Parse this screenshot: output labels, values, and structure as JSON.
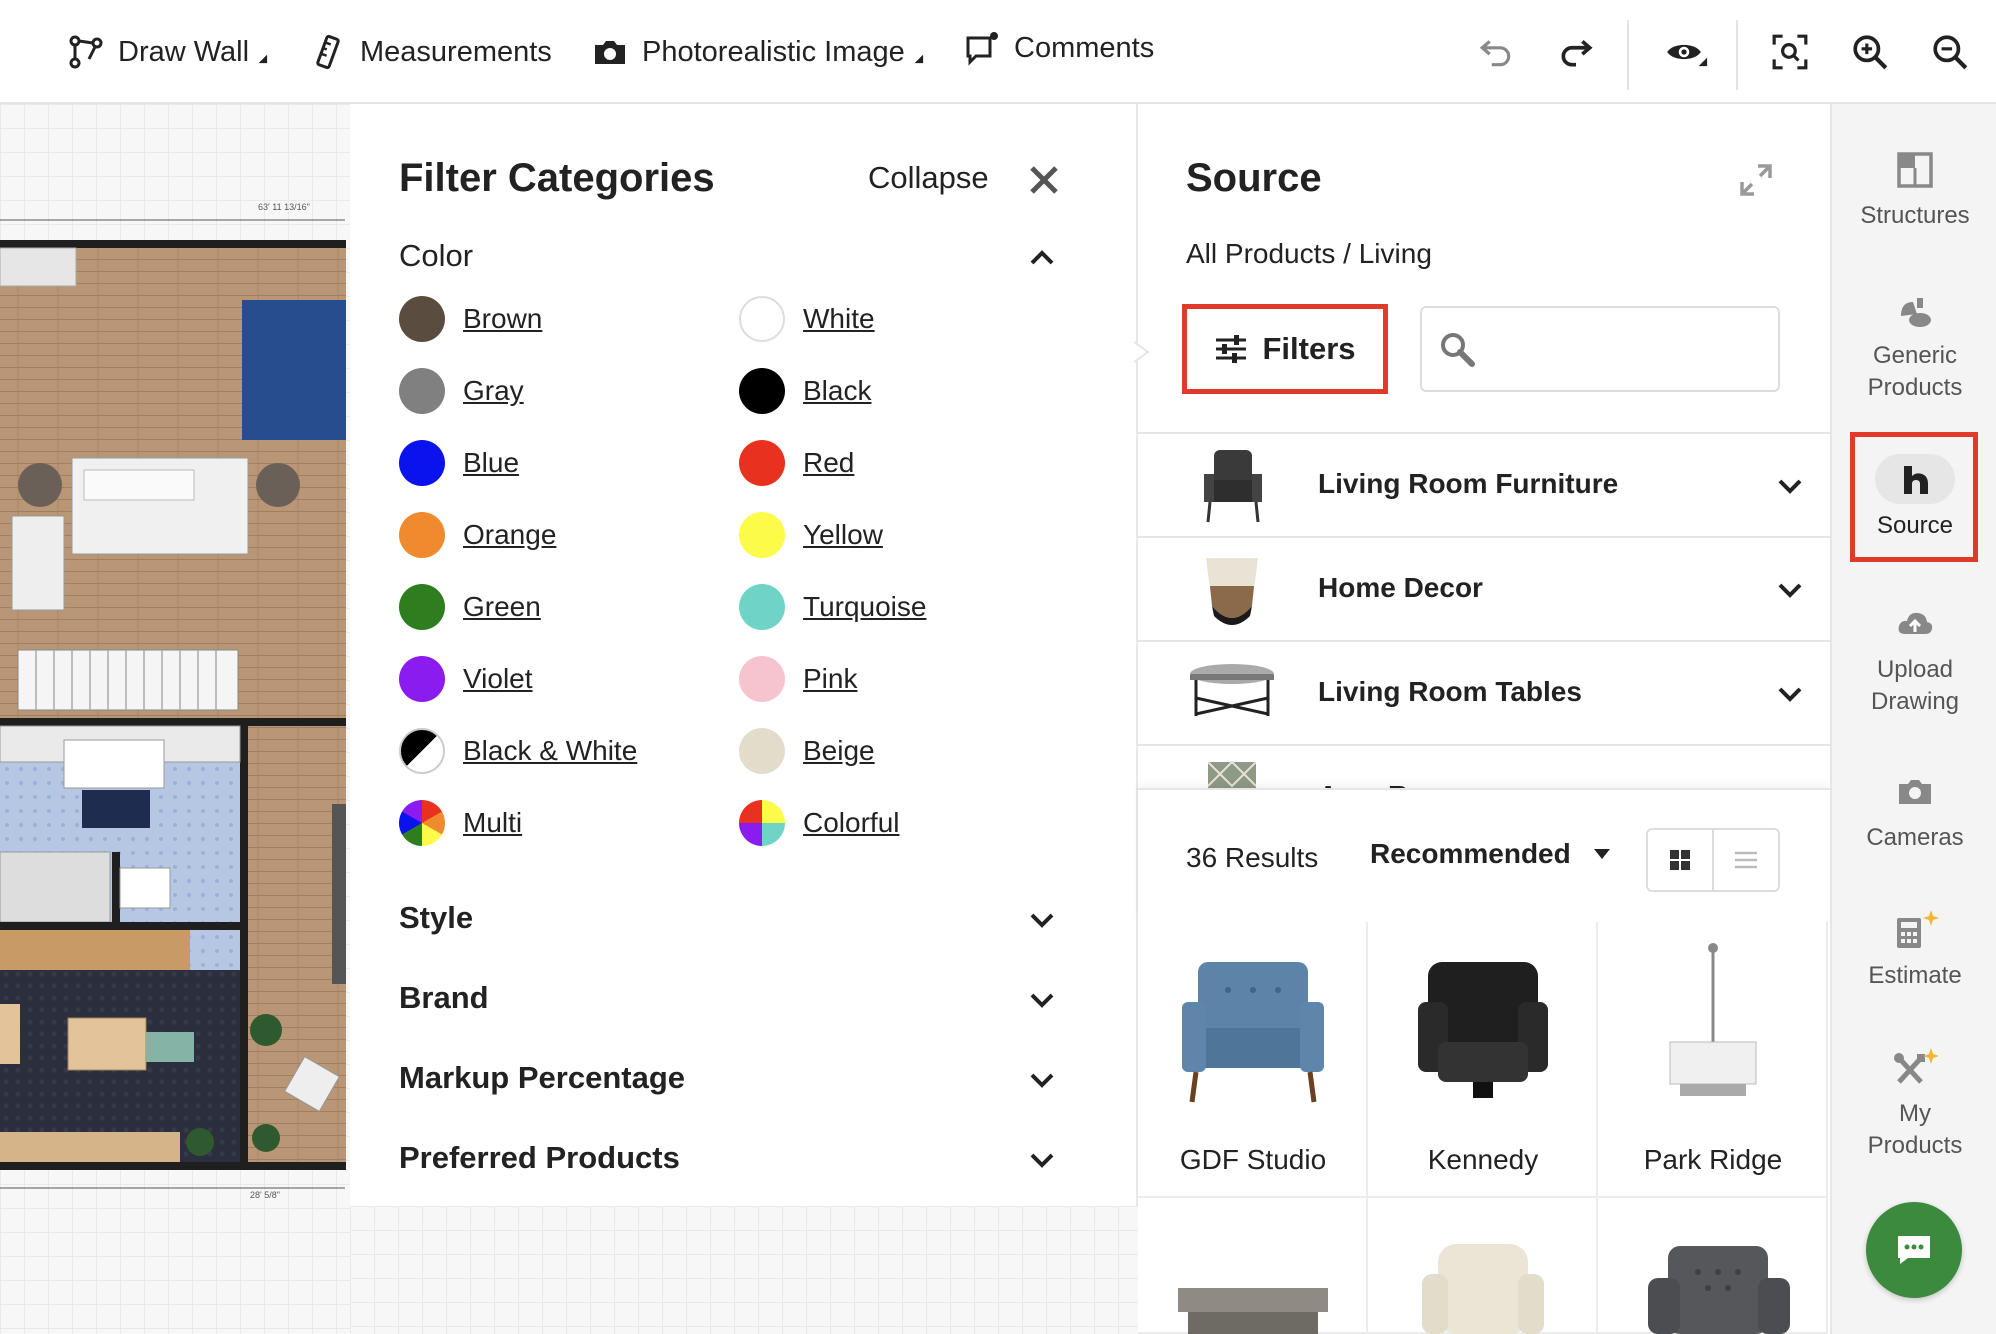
{
  "toolbar": {
    "draw_wall": "Draw Wall",
    "measurements": "Measurements",
    "photorealistic": "Photorealistic Image",
    "comments": "Comments"
  },
  "floorplan": {
    "dim_top": "63' 11 13/16\"",
    "dim_bottom": "28' 5/8\""
  },
  "filter_panel": {
    "title": "Filter Categories",
    "collapse": "Collapse",
    "color_section": "Color",
    "colors_left": [
      {
        "label": "Brown",
        "hex": "#5a4d40"
      },
      {
        "label": "Gray",
        "hex": "#808080"
      },
      {
        "label": "Blue",
        "hex": "#0a12ee"
      },
      {
        "label": "Orange",
        "hex": "#f08a2e"
      },
      {
        "label": "Green",
        "hex": "#2e7d1e"
      },
      {
        "label": "Violet",
        "hex": "#8a1cf0"
      },
      {
        "label": "Black & White",
        "hex": "black-white"
      },
      {
        "label": "Multi",
        "hex": "multi"
      }
    ],
    "colors_right": [
      {
        "label": "White",
        "hex": "#ffffff"
      },
      {
        "label": "Black",
        "hex": "#000000"
      },
      {
        "label": "Red",
        "hex": "#e8311f"
      },
      {
        "label": "Yellow",
        "hex": "#fdfb4a"
      },
      {
        "label": "Turquoise",
        "hex": "#6fd4c8"
      },
      {
        "label": "Pink",
        "hex": "#f6c4ce"
      },
      {
        "label": "Beige",
        "hex": "#e4dccb"
      },
      {
        "label": "Colorful",
        "hex": "colorful"
      }
    ],
    "sections": [
      "Style",
      "Brand",
      "Markup Percentage",
      "Preferred Products"
    ]
  },
  "source_panel": {
    "title": "Source",
    "breadcrumb": "All Products / Living",
    "filters_label": "Filters",
    "search_placeholder": "",
    "categories": [
      "Living Room Furniture",
      "Home Decor",
      "Living Room Tables",
      "Area Rugs"
    ],
    "results_count": "36 Results",
    "sort_label": "Recommended",
    "products": [
      "GDF Studio",
      "Kennedy",
      "Park Ridge"
    ]
  },
  "sidebar": {
    "structures": "Structures",
    "generic_products": [
      "Generic",
      "Products"
    ],
    "source": "Source",
    "upload_drawing": [
      "Upload",
      "Drawing"
    ],
    "cameras": "Cameras",
    "estimate": "Estimate",
    "my_products": [
      "My",
      "Products"
    ]
  },
  "colors": {
    "accent_red": "#e03a2a",
    "chat_green": "#3b8a3e"
  }
}
